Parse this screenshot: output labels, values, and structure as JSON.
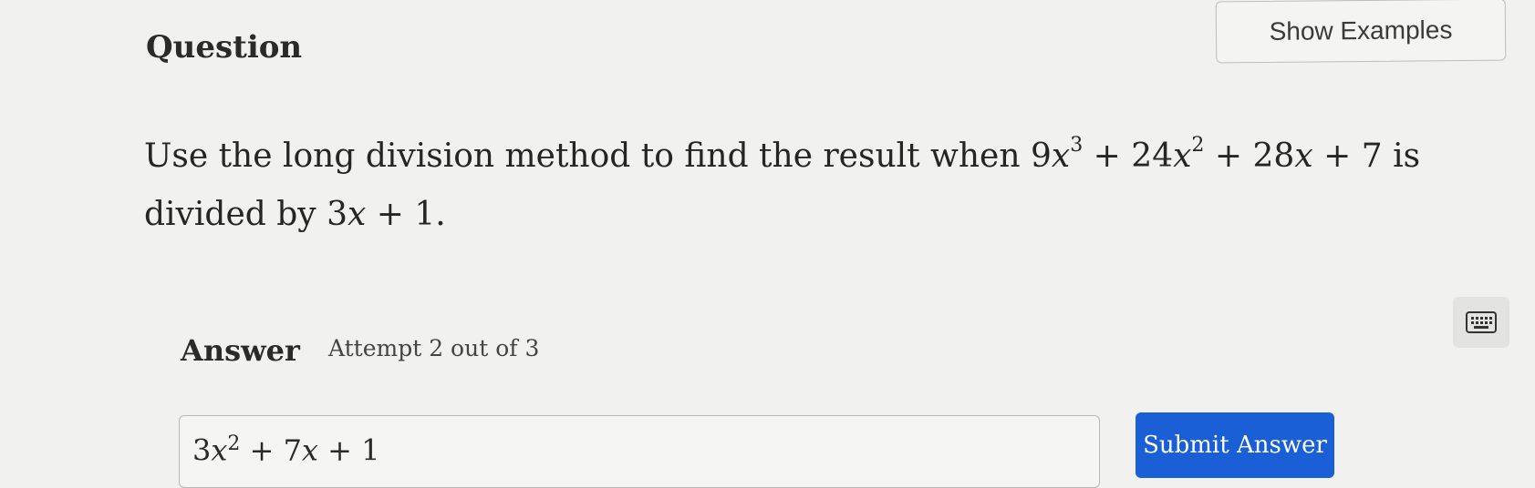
{
  "header": {
    "title": "Question",
    "show_examples_label": "Show Examples"
  },
  "question": {
    "prefix": "Use the long division method to find the result when",
    "dividend": {
      "c3": "9",
      "var": "x",
      "e3": "3",
      "c2": "24",
      "e2": "2",
      "c1": "28",
      "c0": "7",
      "plus": "+"
    },
    "middle": "is divided by",
    "divisor": {
      "c1": "3",
      "var": "x",
      "c0": "1",
      "plus": "+"
    },
    "end": "."
  },
  "answer": {
    "label": "Answer",
    "attempt": "Attempt 2 out of 3",
    "input_value": {
      "c2": "3",
      "var": "x",
      "e2": "2",
      "c1": "7",
      "c0": "1",
      "plus": "+"
    },
    "submit_label": "Submit Answer"
  },
  "icons": {
    "keyboard": "keyboard-icon"
  },
  "colors": {
    "background": "#f1f1ef",
    "submit_button": "#1a5fd6",
    "submit_text": "#ffffff"
  }
}
